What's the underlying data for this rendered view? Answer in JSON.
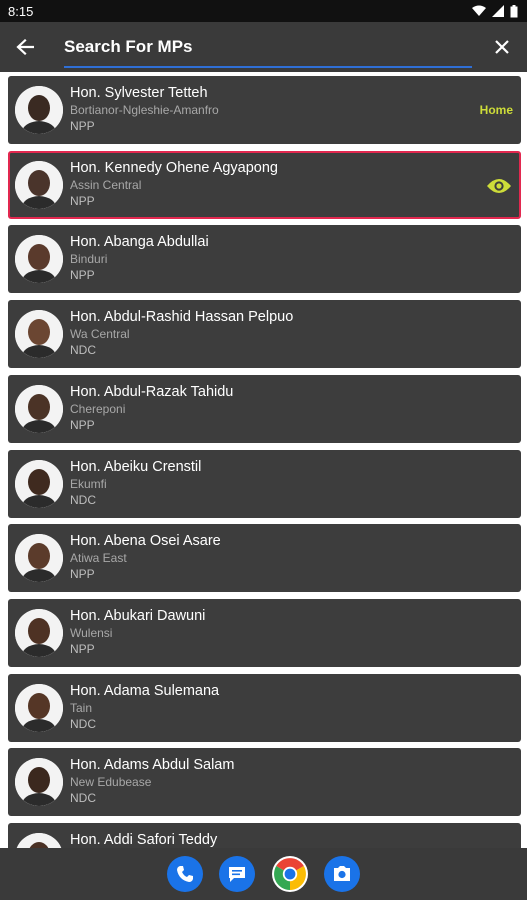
{
  "status_bar": {
    "time": "8:15"
  },
  "app_bar": {
    "search_placeholder": "Search For MPs"
  },
  "colors": {
    "accent": "#cddc39",
    "selected_border": "#e2284f",
    "search_underline": "#2f6fd6"
  },
  "mps": [
    {
      "name": "Hon. Sylvester Tetteh",
      "constituency": "Bortianor-Ngleshie-Amanfro",
      "party": "NPP",
      "badge": "Home",
      "skin": "#3a2a22"
    },
    {
      "name": "Hon. Kennedy Ohene Agyapong",
      "constituency": "Assin Central",
      "party": "NPP",
      "selected": true,
      "icon": "eye-icon",
      "skin": "#4a342b"
    },
    {
      "name": "Hon. Abanga Abdullai",
      "constituency": "Binduri",
      "party": "NPP",
      "skin": "#5a3a2c"
    },
    {
      "name": "Hon. Abdul-Rashid Hassan Pelpuo",
      "constituency": "Wa Central",
      "party": "NDC",
      "skin": "#6b4632"
    },
    {
      "name": "Hon. Abdul-Razak Tahidu",
      "constituency": "Chereponi",
      "party": "NPP",
      "skin": "#4b3326"
    },
    {
      "name": "Hon. Abeiku Crenstil",
      "constituency": "Ekumfi",
      "party": "NDC",
      "skin": "#3f2a1f"
    },
    {
      "name": "Hon. Abena Osei Asare",
      "constituency": "Atiwa East",
      "party": "NPP",
      "skin": "#5b3b2b"
    },
    {
      "name": "Hon. Abukari Dawuni",
      "constituency": "Wulensi",
      "party": "NPP",
      "skin": "#4e3224"
    },
    {
      "name": "Hon. Adama Sulemana",
      "constituency": "Tain",
      "party": "NDC",
      "skin": "#553626"
    },
    {
      "name": "Hon. Adams Abdul Salam",
      "constituency": "New Edubease",
      "party": "NDC",
      "skin": "#3b281e"
    },
    {
      "name": "Hon. Addi Safori Teddy",
      "constituency": "",
      "party": "",
      "skin": "#4a3125"
    }
  ],
  "dock": [
    {
      "name": "phone-app-icon",
      "color": "#1a73e8"
    },
    {
      "name": "messages-app-icon",
      "color": "#1a73e8"
    },
    {
      "name": "chrome-app-icon",
      "color": "#ffffff"
    },
    {
      "name": "camera-app-icon",
      "color": "#1a73e8"
    }
  ]
}
